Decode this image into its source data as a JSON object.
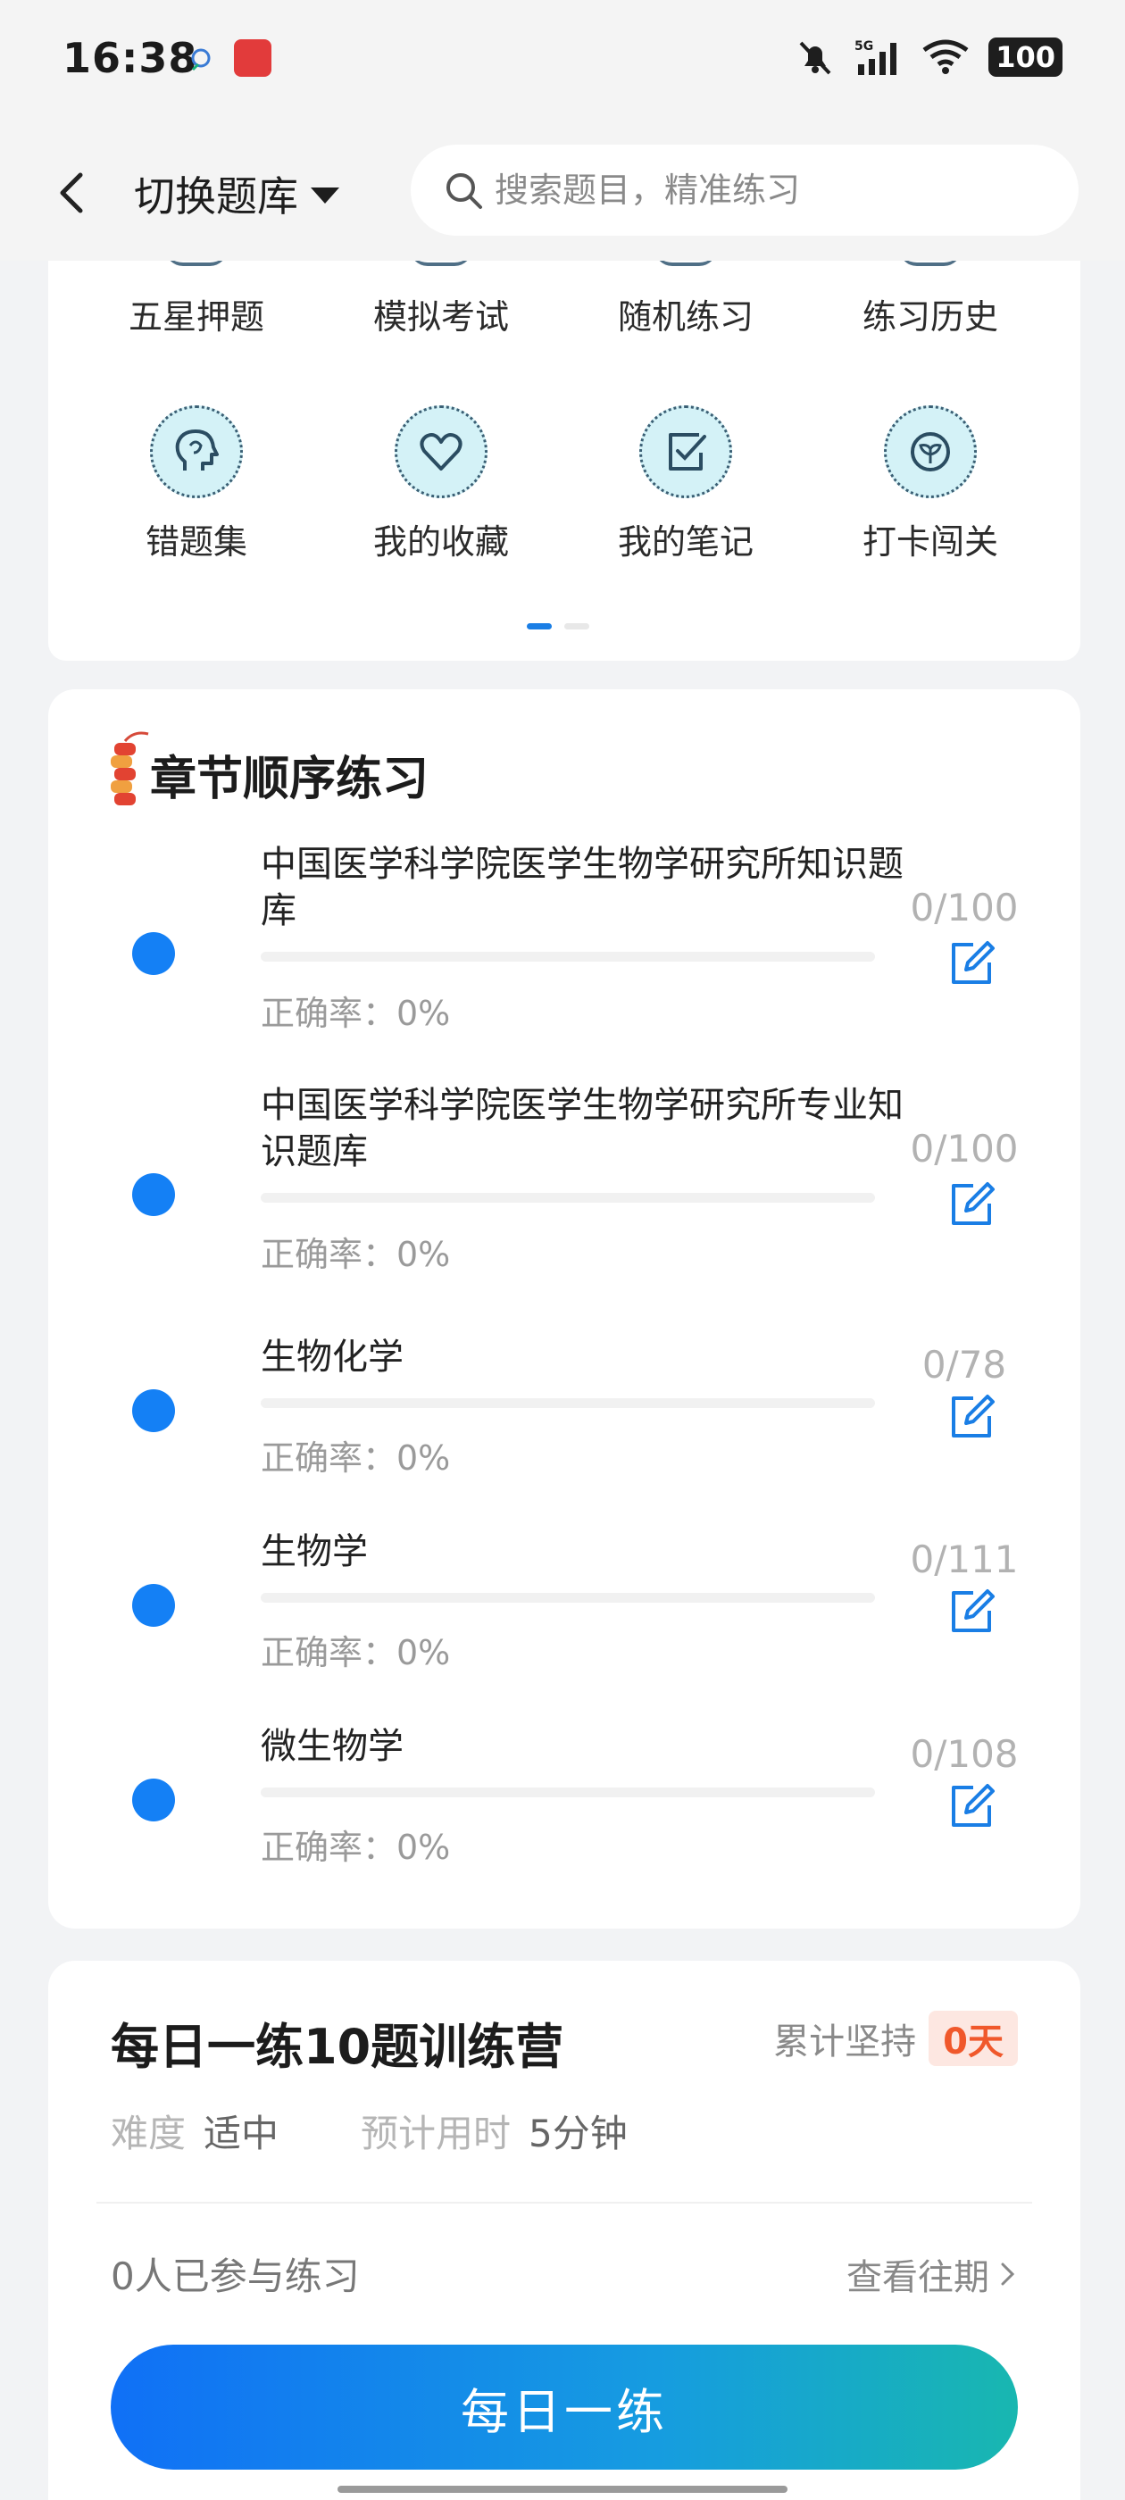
{
  "status_bar": {
    "time": "16:38",
    "network": "5G",
    "battery": "100"
  },
  "header": {
    "switch_label": "切换题库",
    "search_placeholder": "搜索题目，精准练习"
  },
  "feature_grid": {
    "row1": [
      {
        "label": "五星押题"
      },
      {
        "label": "模拟考试"
      },
      {
        "label": "随机练习"
      },
      {
        "label": "练习历史"
      }
    ],
    "row2": [
      {
        "label": "错题集",
        "icon": "head-icon"
      },
      {
        "label": "我的收藏",
        "icon": "heart-icon"
      },
      {
        "label": "我的笔记",
        "icon": "note-check-icon"
      },
      {
        "label": "打卡闯关",
        "icon": "badge-check-icon"
      }
    ],
    "page_indicator": {
      "current": 1,
      "total": 2
    }
  },
  "chapter": {
    "title": "章节顺序练习",
    "items": [
      {
        "name": "中国医学科学院医学生物学研究所知识题库",
        "accuracy": "正确率：0%",
        "count": "0/100",
        "progress": 0
      },
      {
        "name": "中国医学科学院医学生物学研究所专业知识题库",
        "accuracy": "正确率：0%",
        "count": "0/100",
        "progress": 0
      },
      {
        "name": "生物化学",
        "accuracy": "正确率：0%",
        "count": "0/78",
        "progress": 0
      },
      {
        "name": "生物学",
        "accuracy": "正确率：0%",
        "count": "0/111",
        "progress": 0
      },
      {
        "name": "微生物学",
        "accuracy": "正确率：0%",
        "count": "0/108",
        "progress": 0
      }
    ]
  },
  "daily": {
    "title": "每日一练10题训练营",
    "persist_label": "累计坚持",
    "persist_days": "0天",
    "difficulty_label": "难度",
    "difficulty_value": "适中",
    "time_label": "预计用时",
    "time_value": "5分钟",
    "participants": "0人已参与练习",
    "past_link": "查看往期",
    "button": "每日一练"
  }
}
